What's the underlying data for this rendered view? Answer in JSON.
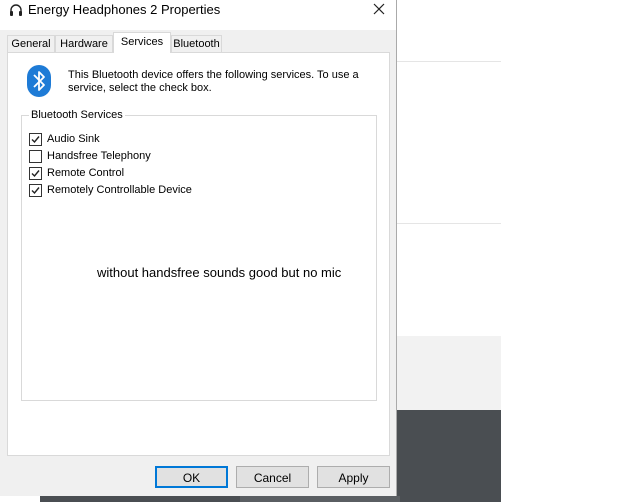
{
  "window": {
    "title": "Energy Headphones 2 Properties",
    "close_symbol": "✕"
  },
  "tabs": [
    {
      "label": "General",
      "active": false
    },
    {
      "label": "Hardware",
      "active": false
    },
    {
      "label": "Services",
      "active": true
    },
    {
      "label": "Bluetooth",
      "active": false
    }
  ],
  "panel": {
    "info_text": "This Bluetooth device offers the following services. To use a service, select the check box.",
    "group_label": "Bluetooth Services",
    "services": [
      {
        "label": "Audio Sink",
        "checked": true
      },
      {
        "label": "Handsfree Telephony",
        "checked": false
      },
      {
        "label": "Remote Control",
        "checked": true
      },
      {
        "label": "Remotely Controllable Device",
        "checked": true
      }
    ],
    "annotation": "without handsfree sounds good but no mic"
  },
  "buttons": {
    "ok": "OK",
    "cancel": "Cancel",
    "apply": "Apply"
  },
  "icons": {
    "title": "headphones-icon",
    "bluetooth": "bluetooth-icon",
    "close": "close-icon",
    "checkmark": "checkmark-icon"
  },
  "colors": {
    "bluetooth_blue": "#1e7bd6",
    "default_button_border": "#0078d7"
  }
}
